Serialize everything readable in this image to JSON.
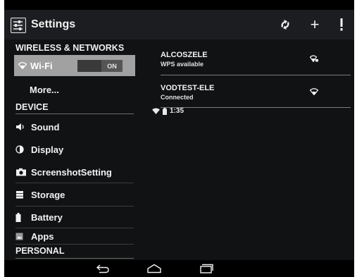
{
  "status_bar": {
    "time": "1:35",
    "icons": [
      "wifi-icon",
      "battery-icon"
    ]
  },
  "action_bar": {
    "title": "Settings",
    "icons": [
      "settings-app-icon",
      "wps-icon",
      "add-icon",
      "overflow-icon"
    ],
    "add_label": "+"
  },
  "sidebar": {
    "sections": {
      "wireless": "WIRELESS & NETWORKS",
      "device": "DEVICE",
      "personal": "PERSONAL"
    },
    "wifi": {
      "label": "Wi-Fi",
      "toggle": "ON",
      "icon": "wifi-icon"
    },
    "more_label": "More...",
    "items": [
      {
        "label": "Sound",
        "icon": "sound-icon"
      },
      {
        "label": "Display",
        "icon": "display-icon"
      },
      {
        "label": "ScreenshotSetting",
        "icon": "camera-icon"
      },
      {
        "label": "Storage",
        "icon": "storage-icon"
      },
      {
        "label": "Battery",
        "icon": "battery-icon"
      },
      {
        "label": "Apps",
        "icon": "apps-icon"
      }
    ]
  },
  "networks": [
    {
      "ssid": "ALCOSZELE",
      "status": "WPS available",
      "icon": "wifi-locked-icon"
    },
    {
      "ssid": "VODTEST-ELE",
      "status": "Connected",
      "icon": "wifi-icon"
    }
  ],
  "nav_bar": {
    "icons": [
      "back-icon",
      "home-icon",
      "recents-icon"
    ]
  },
  "colors": {
    "background": "#111214",
    "selected": "#a1a1a1",
    "bars": "#000000"
  }
}
